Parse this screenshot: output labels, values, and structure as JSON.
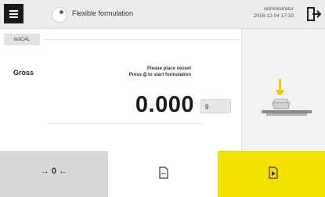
{
  "header": {
    "title": "Flexible formulation",
    "user": "Administrator",
    "datetime": "2016-12-04  17:33"
  },
  "main": {
    "isocal_label": "isoCAL",
    "gross_label": "Gross",
    "instruction_line1": "Please place vessel",
    "instruction_line2": "Press ⎙ to start formulation",
    "weight_value": "0.000",
    "unit": "g"
  },
  "footer": {
    "tare_label": "→ 0 ←"
  },
  "colors": {
    "accent": "#f5e100",
    "header_bg": "#ececec",
    "tare_bg": "#d8d8d8"
  }
}
